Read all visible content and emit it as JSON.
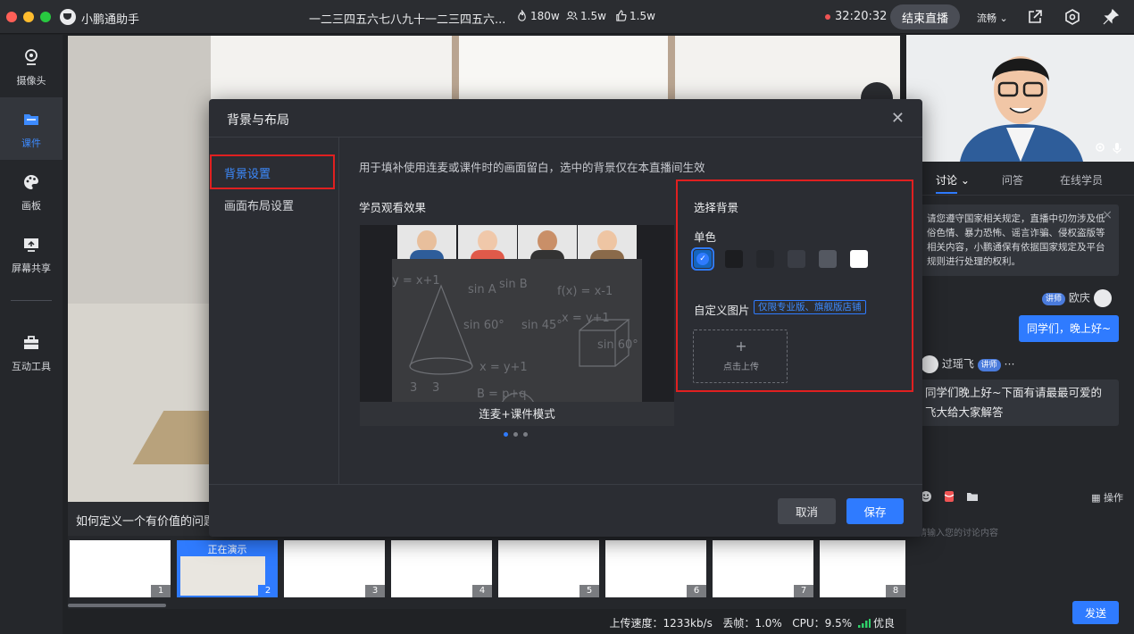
{
  "window": {
    "app_name": "小鹏通助手",
    "live_title": "一二三四五六七八九十一二三四五六...",
    "stats": {
      "views": "180w",
      "viewers": "1.5w",
      "likes": "1.5w"
    },
    "timer": "32:20:32",
    "end_live_label": "结束直播",
    "quality_label": "流畅",
    "colors": {
      "close": "#ff5f57",
      "minimize": "#febc2e",
      "maximize": "#28c840"
    }
  },
  "sidebar": {
    "items": [
      {
        "label": "摄像头",
        "icon": "camera-icon"
      },
      {
        "label": "课件",
        "icon": "folder-icon"
      },
      {
        "label": "画板",
        "icon": "palette-icon"
      },
      {
        "label": "屏幕共享",
        "icon": "screen-share-icon"
      },
      {
        "label": "互动工具",
        "icon": "toolbox-icon"
      }
    ]
  },
  "stage": {
    "course_title": "如何定义一个有价值的问题"
  },
  "thumbnails": {
    "current_label": "正在演示",
    "pages": [
      "1",
      "2",
      "3",
      "4",
      "5",
      "6",
      "7",
      "8"
    ]
  },
  "status_bar": {
    "upload_speed": "上传速度：1233kb/s",
    "frame_loss": "丢帧：1.0%",
    "cpu": "CPU：9.5%",
    "network": "优良"
  },
  "right_panel": {
    "tabs": [
      "讨论",
      "问答",
      "在线学员"
    ],
    "notice": "请您遵守国家相关规定，直播中切勿涉及低俗色情、暴力恐怖、谣言诈骗、侵权盗版等相关内容，小鹏通保有依据国家规定及平台规则进行处理的权利。",
    "messages": [
      {
        "badge": "讲师",
        "name": "欧庆",
        "text": "同学们，晚上好~"
      },
      {
        "badge": "讲师",
        "name": "过瑶飞",
        "text": "同学们晚上好~下面有请最最可爱的飞大给大家解答"
      }
    ],
    "ops_label": "操作",
    "input_placeholder": "请输入您的讨论内容",
    "send_label": "发送"
  },
  "modal": {
    "title": "背景与布局",
    "nav": [
      "背景设置",
      "画面布局设置"
    ],
    "description": "用于填补使用连麦或课件时的画面留白，选中的背景仅在本直播间生效",
    "preview_label": "学员观看效果",
    "preview_caption": "连麦+课件模式",
    "select_bg_title": "选择背景",
    "solid_label": "单色",
    "swatches": [
      "#1565c0",
      "#1c1d20",
      "#25272c",
      "#3a3d45",
      "#545861",
      "#ffffff"
    ],
    "custom_label": "自定义图片",
    "custom_tag": "仅限专业版、旗舰版店铺",
    "upload_label": "点击上传",
    "cancel_label": "取消",
    "save_label": "保存"
  }
}
